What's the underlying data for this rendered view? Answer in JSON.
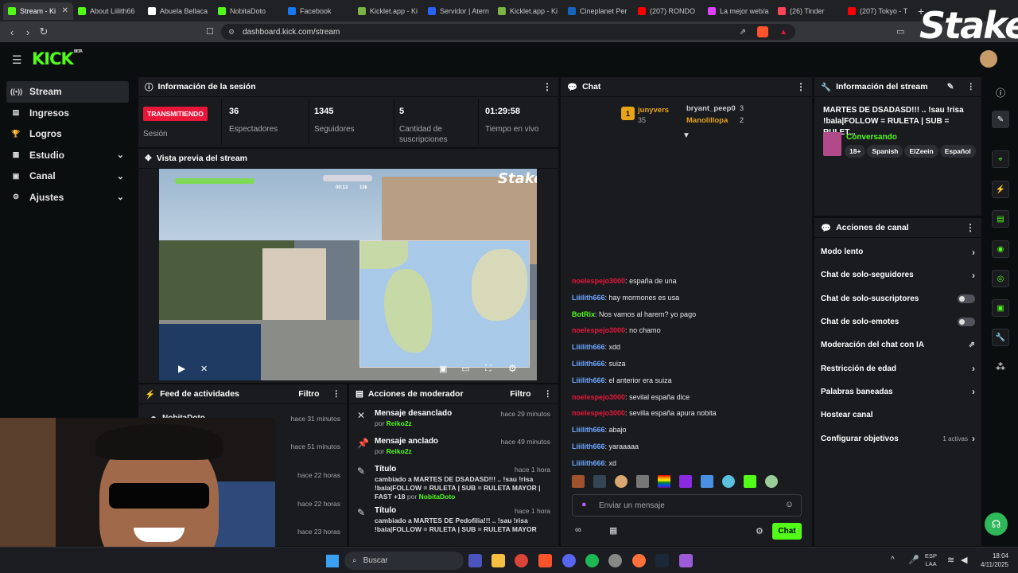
{
  "browser": {
    "tabs": [
      {
        "label": "Stream - Ki",
        "color": "#53fc18"
      },
      {
        "label": "About Liilith66",
        "color": "#53fc18"
      },
      {
        "label": "Abuela Bellaca",
        "color": "#ffffff"
      },
      {
        "label": "NobitaDoto",
        "color": "#53fc18"
      },
      {
        "label": "Facebook",
        "color": "#1877f2"
      },
      {
        "label": "Kicklet.app - Ki",
        "color": "#7cb342"
      },
      {
        "label": "Servidor | Atern",
        "color": "#2962ff"
      },
      {
        "label": "Kicklet.app - Ki",
        "color": "#7cb342"
      },
      {
        "label": "Cineplanet Per",
        "color": "#1565c0"
      },
      {
        "label": "(207) RONDO",
        "color": "#ff0000"
      },
      {
        "label": "La mejor web/a",
        "color": "#e040fb"
      },
      {
        "label": "(26) Tinder",
        "color": "#ff4458"
      },
      {
        "label": "(207) Tokyo - T",
        "color": "#ff0000"
      }
    ],
    "new_tab": "+",
    "url": "dashboard.kick.com/stream",
    "stake_watermark": "Stake"
  },
  "header": {
    "logo": "KICK",
    "logo_sup": "BETA"
  },
  "sidebar": {
    "items": [
      {
        "label": "Stream",
        "icon": "broadcast-icon",
        "glyph": "((•))",
        "active": true,
        "chevron": false
      },
      {
        "label": "Ingresos",
        "icon": "wallet-icon",
        "glyph": "▤",
        "active": false,
        "chevron": false
      },
      {
        "label": "Logros",
        "icon": "trophy-icon",
        "glyph": "🏆",
        "active": false,
        "chevron": false
      },
      {
        "label": "Estudio",
        "icon": "studio-icon",
        "glyph": "▦",
        "active": false,
        "chevron": true
      },
      {
        "label": "Canal",
        "icon": "channel-icon",
        "glyph": "▣",
        "active": false,
        "chevron": true
      },
      {
        "label": "Ajustes",
        "icon": "gear-icon",
        "glyph": "⚙",
        "active": false,
        "chevron": true
      }
    ]
  },
  "session": {
    "title": "Información de la sesión",
    "badge": "TRANSMITIENDO",
    "badge_label": "Sesión",
    "stats": [
      {
        "value": "36",
        "label": "Espectadores"
      },
      {
        "value": "1345",
        "label": "Seguidores"
      },
      {
        "value": "5",
        "label": "Cantidad de suscripciones"
      },
      {
        "value": "01:29:58",
        "label": "Tiempo en vivo"
      }
    ]
  },
  "preview": {
    "title": "Vista previa del stream",
    "stake_overlay": "Stake",
    "timer": "00:13",
    "score": "13k"
  },
  "feed": {
    "title": "Feed de actividades",
    "filter": "Filtro",
    "items": [
      {
        "user": "NobitaDoto",
        "time": "hace 31 minutos"
      },
      {
        "user": "",
        "time": "hace 51 minutos"
      },
      {
        "user": "",
        "time": "hace 22 horas"
      },
      {
        "user": "",
        "time": "hace 22 horas"
      },
      {
        "user": "",
        "time": "hace 23 horas"
      }
    ]
  },
  "moderator": {
    "title": "Acciones de moderador",
    "filter": "Filtro",
    "items": [
      {
        "title": "Mensaje desanclado",
        "by_prefix": "por",
        "by": "Reiko2z",
        "time": "hace 29 minutos",
        "icon": "unpin-icon",
        "glyph": "✕"
      },
      {
        "title": "Mensaje anclado",
        "by_prefix": "por",
        "by": "Reiko2z",
        "time": "hace 49 minutos",
        "icon": "pin-icon",
        "glyph": "📌"
      },
      {
        "title": "Título",
        "detail": "cambiado a MARTES DE DSADASD!!! .. !sau !risa !bala|FOLLOW = RULETA | SUB = RULETA MAYOR | FAST +18",
        "by_prefix": "por",
        "by": "NobitaDoto",
        "time": "hace 1 hora",
        "icon": "title-icon",
        "glyph": "✎"
      },
      {
        "title": "Título",
        "detail": "cambiado a MARTES DE Pedofilia!!! .. !sau !risa !bala|FOLLOW = RULETA | SUB = RULETA MAYOR",
        "by_prefix": "",
        "by": "",
        "time": "hace 1 hora",
        "icon": "title-icon",
        "glyph": "✎"
      }
    ]
  },
  "chat": {
    "title": "Chat",
    "leaders": [
      {
        "rank": "1",
        "name": "junyvers",
        "count": "35"
      },
      {
        "rank": "",
        "name": "bryant_peep0",
        "count": "3"
      },
      {
        "rank": "",
        "name": "Manolillopa",
        "count": "2"
      }
    ],
    "messages": [
      {
        "user": "noelespejo3000",
        "text": "españa de una",
        "color": "red"
      },
      {
        "user": "Liiilith666",
        "text": "hay mormones es usa",
        "color": "blue"
      },
      {
        "user": "BotRix",
        "text": "Nos vamos al harem? yo pago",
        "color": "green"
      },
      {
        "user": "noelespejo3000",
        "text": "no chamo",
        "color": "red"
      },
      {
        "user": "Liiilith666",
        "text": "xdd",
        "color": "blue"
      },
      {
        "user": "Liiilith666",
        "text": "suiza",
        "color": "blue"
      },
      {
        "user": "Liiilith666",
        "text": "el anterior era suiza",
        "color": "blue"
      },
      {
        "user": "noelespejo3000",
        "text": "sevilal españa dice",
        "color": "red"
      },
      {
        "user": "noelespejo3000",
        "text": "sevilla españa apura nobita",
        "color": "red"
      },
      {
        "user": "Liiilith666",
        "text": "abajo",
        "color": "blue"
      },
      {
        "user": "Liiilith666",
        "text": "yaraaaaa",
        "color": "blue"
      },
      {
        "user": "Liiilith666",
        "text": "xd",
        "color": "blue"
      }
    ],
    "input_placeholder": "Enviar un mensaje",
    "send_label": "Chat"
  },
  "stream_info": {
    "title": "Información del stream",
    "stream_title": "MARTES DE DSADASD!!! .. !sau !risa !bala|FOLLOW = RULETA | SUB = RULET...",
    "category": "Conversando",
    "tags": [
      "18+",
      "Spanish",
      "ElZeein",
      "Español"
    ]
  },
  "channel_actions": {
    "title": "Acciones de canal",
    "items": [
      {
        "label": "Modo lento",
        "control": "chevron"
      },
      {
        "label": "Chat de solo-seguidores",
        "control": "chevron"
      },
      {
        "label": "Chat de solo-suscriptores",
        "control": "toggle"
      },
      {
        "label": "Chat de solo-emotes",
        "control": "toggle"
      },
      {
        "label": "Moderación del chat con IA",
        "control": "external"
      },
      {
        "label": "Restricción de edad",
        "control": "chevron"
      },
      {
        "label": "Palabras baneadas",
        "control": "chevron"
      },
      {
        "label": "Hostear canal",
        "control": "none"
      },
      {
        "label": "Configurar objetivos",
        "control": "goals"
      }
    ],
    "goals_badge": "1 activas"
  },
  "taskbar": {
    "search": "Buscar",
    "lang": "ESP",
    "lang2": "LAA",
    "time": "18:04",
    "date": "4/11/2025"
  }
}
